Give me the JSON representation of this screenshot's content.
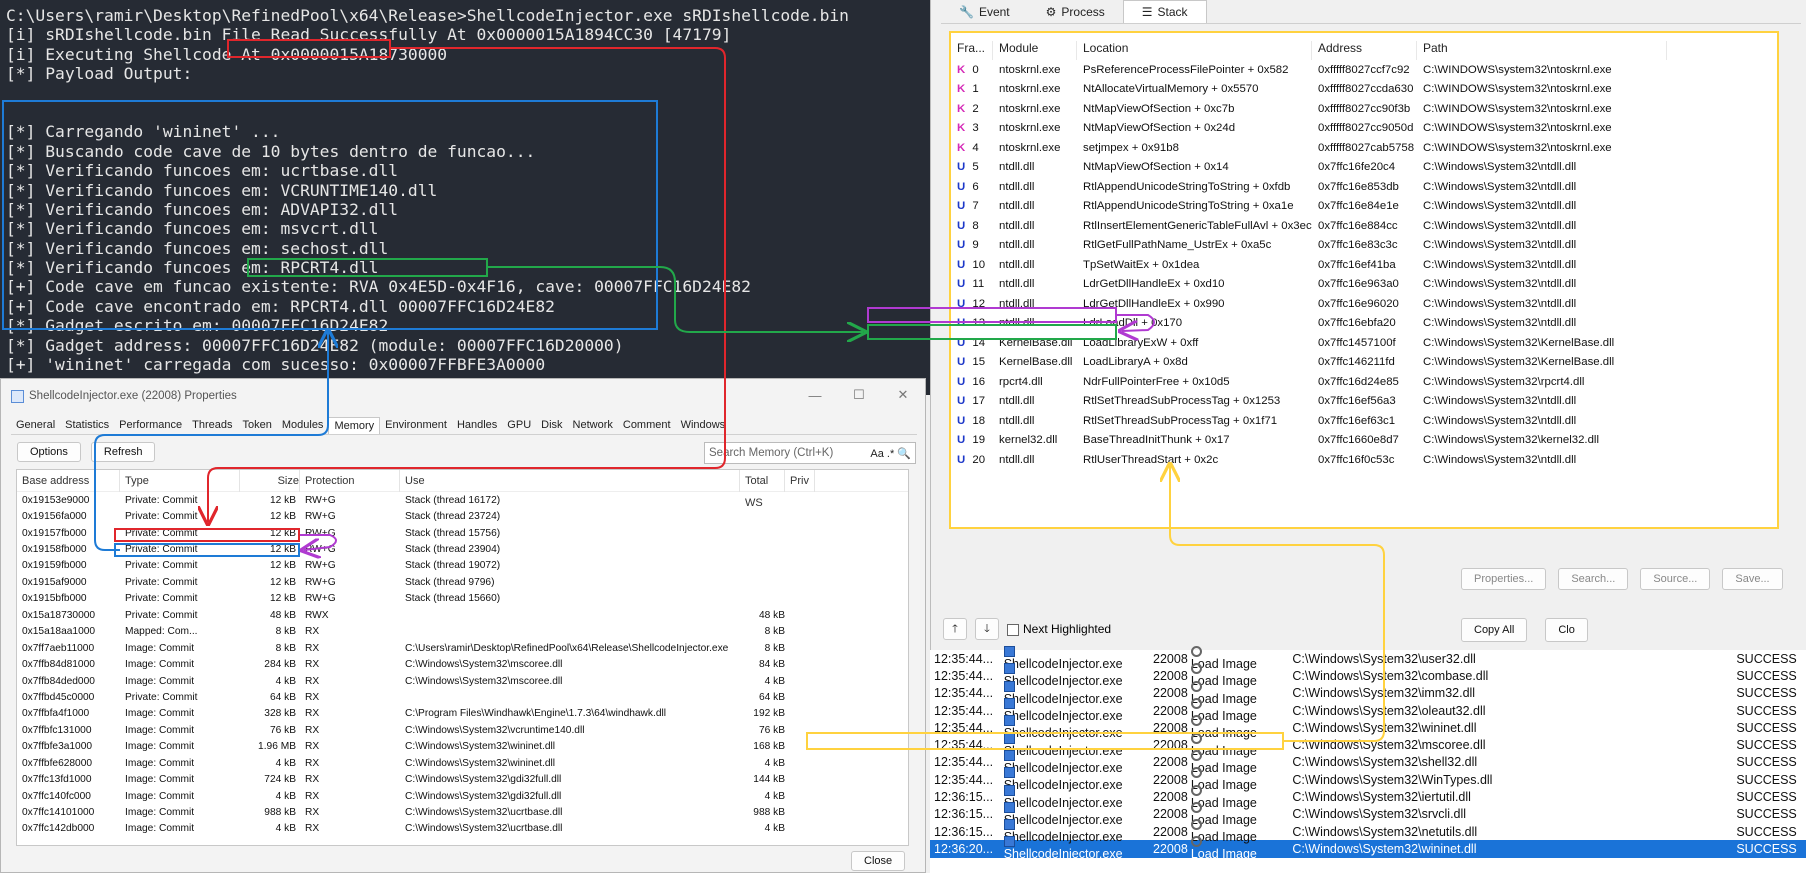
{
  "terminal": {
    "lines": [
      "C:\\Users\\ramir\\Desktop\\RefinedPool\\x64\\Release>ShellcodeInjector.exe sRDIshellcode.bin",
      "[i] sRDIshellcode.bin File Read Successfully At 0x0000015A1894CC30 [47179]",
      "[i] Executing Shellcode At 0x0000015A18730000",
      "[*] Payload Output:",
      "",
      "",
      "[*] Carregando 'wininet' ...",
      "[*] Buscando code cave de 10 bytes dentro de funcao...",
      "[*] Verificando funcoes em: ucrtbase.dll",
      "[*] Verificando funcoes em: VCRUNTIME140.dll",
      "[*] Verificando funcoes em: ADVAPI32.dll",
      "[*] Verificando funcoes em: msvcrt.dll",
      "[*] Verificando funcoes em: sechost.dll",
      "[*] Verificando funcoes em: RPCRT4.dll",
      "[+] Code cave em funcao existente: RVA 0x4E5D-0x4F16, cave: 00007FFC16D24E82",
      "[+] Code cave encontrado em: RPCRT4.dll 00007FFC16D24E82",
      "[*] Gadget escrito em: 00007FFC16D24E82",
      "[*] Gadget address: 00007FFC16D24E82 (module: 00007FFC16D20000)",
      "[+] 'wininet' carregada com sucesso: 0x00007FFBFE3A0000"
    ]
  },
  "props": {
    "title": "ShellcodeInjector.exe (22008) Properties",
    "tabs": [
      "General",
      "Statistics",
      "Performance",
      "Threads",
      "Token",
      "Modules",
      "Memory",
      "Environment",
      "Handles",
      "GPU",
      "Disk",
      "Network",
      "Comment",
      "Windows"
    ],
    "active_tab": "Memory",
    "options_label": "Options",
    "refresh_label": "Refresh",
    "search_placeholder": "Search Memory (Ctrl+K)",
    "search_opts": "Aa .*",
    "columns": [
      "Base address",
      "Type",
      "Size",
      "Protection",
      "Use",
      "Total WS",
      "Priv"
    ],
    "rows": [
      [
        "0x19153e9000",
        "Private: Commit",
        "12 kB",
        "RW+G",
        "Stack (thread 16172)",
        ""
      ],
      [
        "0x19156fa000",
        "Private: Commit",
        "12 kB",
        "RW+G",
        "Stack (thread 23724)",
        ""
      ],
      [
        "0x19157fb000",
        "Private: Commit",
        "12 kB",
        "RW+G",
        "Stack (thread 15756)",
        ""
      ],
      [
        "0x19158fb000",
        "Private: Commit",
        "12 kB",
        "RW+G",
        "Stack (thread 23904)",
        ""
      ],
      [
        "0x19159fb000",
        "Private: Commit",
        "12 kB",
        "RW+G",
        "Stack (thread 19072)",
        ""
      ],
      [
        "0x1915af9000",
        "Private: Commit",
        "12 kB",
        "RW+G",
        "Stack (thread 9796)",
        ""
      ],
      [
        "0x1915bfb000",
        "Private: Commit",
        "12 kB",
        "RW+G",
        "Stack (thread 15660)",
        ""
      ],
      [
        "0x15a18730000",
        "Private: Commit",
        "48 kB",
        "RWX",
        "",
        "48 kB"
      ],
      [
        "0x15a18aa1000",
        "Mapped: Com...",
        "8 kB",
        "RX",
        "",
        "8 kB"
      ],
      [
        "0x7ff7aeb11000",
        "Image: Commit",
        "8 kB",
        "RX",
        "C:\\Users\\ramir\\Desktop\\RefinedPool\\x64\\Release\\ShellcodeInjector.exe",
        "8 kB"
      ],
      [
        "0x7ffb84d81000",
        "Image: Commit",
        "284 kB",
        "RX",
        "C:\\Windows\\System32\\mscoree.dll",
        "84 kB"
      ],
      [
        "0x7ffb84ded000",
        "Image: Commit",
        "4 kB",
        "RX",
        "C:\\Windows\\System32\\mscoree.dll",
        "4 kB"
      ],
      [
        "0x7ffbd45c0000",
        "Private: Commit",
        "64 kB",
        "RX",
        "",
        "64 kB"
      ],
      [
        "0x7ffbfa4f1000",
        "Image: Commit",
        "328 kB",
        "RX",
        "C:\\Program Files\\Windhawk\\Engine\\1.7.3\\64\\windhawk.dll",
        "192 kB"
      ],
      [
        "0x7ffbfc131000",
        "Image: Commit",
        "76 kB",
        "RX",
        "C:\\Windows\\System32\\vcruntime140.dll",
        "76 kB"
      ],
      [
        "0x7ffbfe3a1000",
        "Image: Commit",
        "1.96 MB",
        "RX",
        "C:\\Windows\\System32\\wininet.dll",
        "168 kB"
      ],
      [
        "0x7ffbfe628000",
        "Image: Commit",
        "4 kB",
        "RX",
        "C:\\Windows\\System32\\wininet.dll",
        "4 kB"
      ],
      [
        "0x7ffc13fd1000",
        "Image: Commit",
        "724 kB",
        "RX",
        "C:\\Windows\\System32\\gdi32full.dll",
        "144 kB"
      ],
      [
        "0x7ffc140fc000",
        "Image: Commit",
        "4 kB",
        "RX",
        "C:\\Windows\\System32\\gdi32full.dll",
        "4 kB"
      ],
      [
        "0x7ffc14101000",
        "Image: Commit",
        "988 kB",
        "RX",
        "C:\\Windows\\System32\\ucrtbase.dll",
        "988 kB"
      ],
      [
        "0x7ffc142db000",
        "Image: Commit",
        "4 kB",
        "RX",
        "C:\\Windows\\System32\\ucrtbase.dll",
        "4 kB"
      ]
    ],
    "close_label": "Close"
  },
  "stack": {
    "tabs": [
      "Event",
      "Process",
      "Stack"
    ],
    "active_tab": "Stack",
    "columns": [
      "Fra...",
      "Module",
      "Location",
      "Address",
      "Path"
    ],
    "frames": [
      [
        "K",
        "0",
        "ntoskrnl.exe",
        "PsReferenceProcessFilePointer + 0x582",
        "0xfffff8027ccf7c92",
        "C:\\WINDOWS\\system32\\ntoskrnl.exe"
      ],
      [
        "K",
        "1",
        "ntoskrnl.exe",
        "NtAllocateVirtualMemory + 0x5570",
        "0xfffff8027ccda630",
        "C:\\WINDOWS\\system32\\ntoskrnl.exe"
      ],
      [
        "K",
        "2",
        "ntoskrnl.exe",
        "NtMapViewOfSection + 0xc7b",
        "0xfffff8027cc90f3b",
        "C:\\WINDOWS\\system32\\ntoskrnl.exe"
      ],
      [
        "K",
        "3",
        "ntoskrnl.exe",
        "NtMapViewOfSection + 0x24d",
        "0xfffff8027cc9050d",
        "C:\\WINDOWS\\system32\\ntoskrnl.exe"
      ],
      [
        "K",
        "4",
        "ntoskrnl.exe",
        "setjmpex + 0x91b8",
        "0xfffff8027cab5758",
        "C:\\WINDOWS\\system32\\ntoskrnl.exe"
      ],
      [
        "U",
        "5",
        "ntdll.dll",
        "NtMapViewOfSection + 0x14",
        "0x7ffc16fe20c4",
        "C:\\Windows\\System32\\ntdll.dll"
      ],
      [
        "U",
        "6",
        "ntdll.dll",
        "RtlAppendUnicodeStringToString + 0xfdb",
        "0x7ffc16e853db",
        "C:\\Windows\\System32\\ntdll.dll"
      ],
      [
        "U",
        "7",
        "ntdll.dll",
        "RtlAppendUnicodeStringToString + 0xa1e",
        "0x7ffc16e84e1e",
        "C:\\Windows\\System32\\ntdll.dll"
      ],
      [
        "U",
        "8",
        "ntdll.dll",
        "RtlInsertElementGenericTableFullAvl + 0x3ec",
        "0x7ffc16e884cc",
        "C:\\Windows\\System32\\ntdll.dll"
      ],
      [
        "U",
        "9",
        "ntdll.dll",
        "RtlGetFullPathName_UstrEx + 0xa5c",
        "0x7ffc16e83c3c",
        "C:\\Windows\\System32\\ntdll.dll"
      ],
      [
        "U",
        "10",
        "ntdll.dll",
        "TpSetWaitEx + 0x1dea",
        "0x7ffc16ef41ba",
        "C:\\Windows\\System32\\ntdll.dll"
      ],
      [
        "U",
        "11",
        "ntdll.dll",
        "LdrGetDllHandleEx + 0xd10",
        "0x7ffc16e963a0",
        "C:\\Windows\\System32\\ntdll.dll"
      ],
      [
        "U",
        "12",
        "ntdll.dll",
        "LdrGetDllHandleEx + 0x990",
        "0x7ffc16e96020",
        "C:\\Windows\\System32\\ntdll.dll"
      ],
      [
        "U",
        "13",
        "ntdll.dll",
        "LdrLoadDll + 0x170",
        "0x7ffc16ebfa20",
        "C:\\Windows\\System32\\ntdll.dll"
      ],
      [
        "U",
        "14",
        "KernelBase.dll",
        "LoadLibraryExW + 0xff",
        "0x7ffc1457100f",
        "C:\\Windows\\System32\\KernelBase.dll"
      ],
      [
        "U",
        "15",
        "KernelBase.dll",
        "LoadLibraryA + 0x8d",
        "0x7ffc146211fd",
        "C:\\Windows\\System32\\KernelBase.dll"
      ],
      [
        "U",
        "16",
        "rpcrt4.dll",
        "NdrFullPointerFree + 0x10d5",
        "0x7ffc16d24e85",
        "C:\\Windows\\System32\\rpcrt4.dll"
      ],
      [
        "U",
        "17",
        "ntdll.dll",
        "RtlSetThreadSubProcessTag + 0x1253",
        "0x7ffc16ef56a3",
        "C:\\Windows\\System32\\ntdll.dll"
      ],
      [
        "U",
        "18",
        "ntdll.dll",
        "RtlSetThreadSubProcessTag + 0x1f71",
        "0x7ffc16ef63c1",
        "C:\\Windows\\System32\\ntdll.dll"
      ],
      [
        "U",
        "19",
        "kernel32.dll",
        "BaseThreadInitThunk + 0x17",
        "0x7ffc1660e8d7",
        "C:\\Windows\\System32\\kernel32.dll"
      ],
      [
        "U",
        "20",
        "ntdll.dll",
        "RtlUserThreadStart + 0x2c",
        "0x7ffc16f0c53c",
        "C:\\Windows\\System32\\ntdll.dll"
      ]
    ],
    "buttons": [
      "Properties...",
      "Search...",
      "Source...",
      "Save..."
    ],
    "next_highlighted": "Next Highlighted",
    "copy_all": "Copy All",
    "close_partial": "Clo"
  },
  "events": [
    [
      "12:35:44...",
      "ShellcodeInjector.exe",
      "22008",
      "Load Image",
      "C:\\Windows\\System32\\user32.dll",
      "SUCCESS"
    ],
    [
      "12:35:44...",
      "ShellcodeInjector.exe",
      "22008",
      "Load Image",
      "C:\\Windows\\System32\\combase.dll",
      "SUCCESS"
    ],
    [
      "12:35:44...",
      "ShellcodeInjector.exe",
      "22008",
      "Load Image",
      "C:\\Windows\\System32\\imm32.dll",
      "SUCCESS"
    ],
    [
      "12:35:44...",
      "ShellcodeInjector.exe",
      "22008",
      "Load Image",
      "C:\\Windows\\System32\\oleaut32.dll",
      "SUCCESS"
    ],
    [
      "12:35:44...",
      "ShellcodeInjector.exe",
      "22008",
      "Load Image",
      "C:\\Windows\\System32\\wininet.dll",
      "SUCCESS"
    ],
    [
      "12:35:44...",
      "ShellcodeInjector.exe",
      "22008",
      "Load Image",
      "C:\\Windows\\System32\\mscoree.dll",
      "SUCCESS"
    ],
    [
      "12:35:44...",
      "ShellcodeInjector.exe",
      "22008",
      "Load Image",
      "C:\\Windows\\System32\\shell32.dll",
      "SUCCESS"
    ],
    [
      "12:35:44...",
      "ShellcodeInjector.exe",
      "22008",
      "Load Image",
      "C:\\Windows\\System32\\WinTypes.dll",
      "SUCCESS"
    ],
    [
      "12:36:15...",
      "ShellcodeInjector.exe",
      "22008",
      "Load Image",
      "C:\\Windows\\System32\\iertutil.dll",
      "SUCCESS"
    ],
    [
      "12:36:15...",
      "ShellcodeInjector.exe",
      "22008",
      "Load Image",
      "C:\\Windows\\System32\\srvcli.dll",
      "SUCCESS"
    ],
    [
      "12:36:15...",
      "ShellcodeInjector.exe",
      "22008",
      "Load Image",
      "C:\\Windows\\System32\\netutils.dll",
      "SUCCESS"
    ],
    [
      "12:36:20...",
      "ShellcodeInjector.exe",
      "22008",
      "Load Image",
      "C:\\Windows\\System32\\wininet.dll",
      "SUCCESS"
    ]
  ],
  "colors": {
    "red": "#e0262c",
    "green": "#22a84a",
    "blue": "#1e7bd6",
    "purple": "#b03ad1",
    "yellow": "#ffd23f"
  }
}
